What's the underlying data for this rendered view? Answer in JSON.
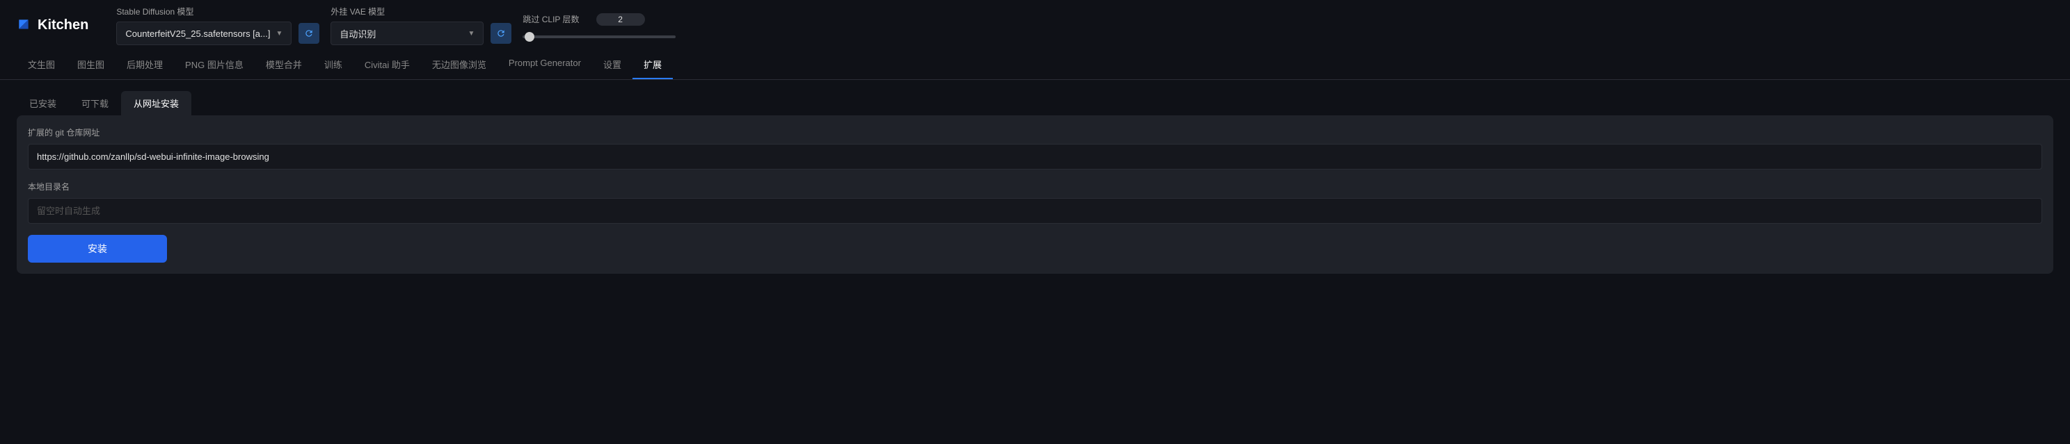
{
  "app": {
    "name": "Kitchen"
  },
  "header": {
    "sdModel": {
      "label": "Stable Diffusion 模型",
      "value": "CounterfeitV25_25.safetensors [a...]"
    },
    "vaeModel": {
      "label": "外挂 VAE 模型",
      "value": "自动识别"
    },
    "clipSkip": {
      "label": "跳过 CLIP 层数",
      "value": "2"
    }
  },
  "mainTabs": [
    {
      "label": "文生图",
      "active": false
    },
    {
      "label": "图生图",
      "active": false
    },
    {
      "label": "后期处理",
      "active": false
    },
    {
      "label": "PNG 图片信息",
      "active": false
    },
    {
      "label": "模型合并",
      "active": false
    },
    {
      "label": "训练",
      "active": false
    },
    {
      "label": "Civitai 助手",
      "active": false
    },
    {
      "label": "无边图像浏览",
      "active": false
    },
    {
      "label": "Prompt Generator",
      "active": false
    },
    {
      "label": "设置",
      "active": false
    },
    {
      "label": "扩展",
      "active": true
    }
  ],
  "subTabs": [
    {
      "label": "已安装",
      "active": false
    },
    {
      "label": "可下载",
      "active": false
    },
    {
      "label": "从网址安装",
      "active": true
    }
  ],
  "form": {
    "urlLabel": "扩展的 git 仓库网址",
    "urlValue": "https://github.com/zanllp/sd-webui-infinite-image-browsing",
    "dirLabel": "本地目录名",
    "dirPlaceholder": "留空时自动生成",
    "dirValue": "",
    "installLabel": "安装"
  }
}
